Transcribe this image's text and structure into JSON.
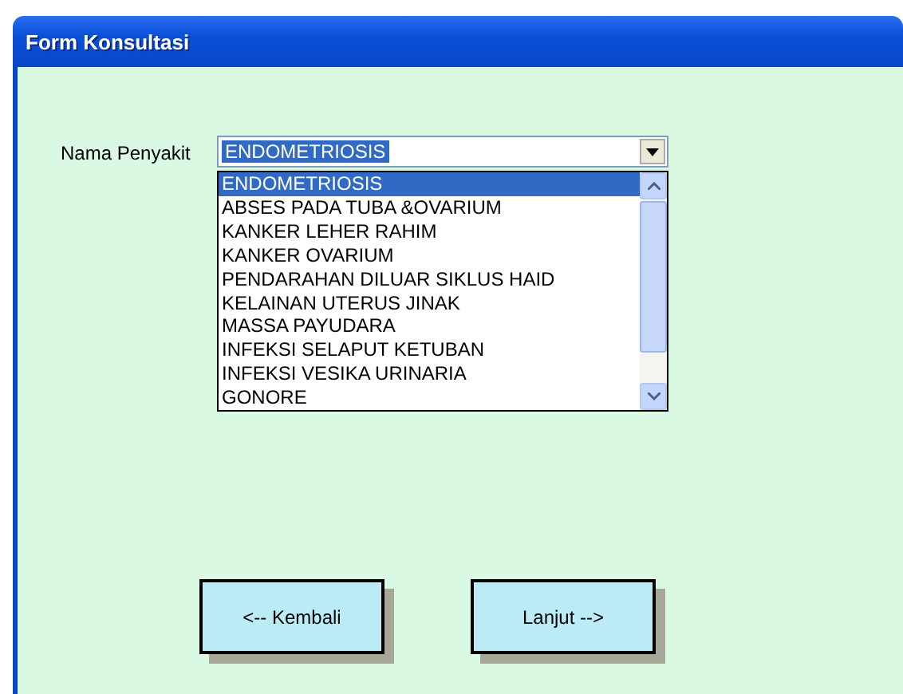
{
  "window": {
    "title": "Form Konsultasi"
  },
  "field": {
    "label": "Nama Penyakit",
    "value": "ENDOMETRIOSIS",
    "expanded": true
  },
  "options": [
    {
      "label": "ENDOMETRIOSIS",
      "selected": true
    },
    {
      "label": "ABSES PADA TUBA &OVARIUM",
      "selected": false
    },
    {
      "label": "KANKER LEHER RAHIM",
      "selected": false
    },
    {
      "label": "KANKER OVARIUM",
      "selected": false
    },
    {
      "label": "PENDARAHAN DILUAR SIKLUS HAID",
      "selected": false
    },
    {
      "label": "KELAINAN UTERUS JINAK",
      "selected": false
    },
    {
      "label": "MASSA PAYUDARA",
      "selected": false
    },
    {
      "label": "INFEKSI SELAPUT KETUBAN",
      "selected": false
    },
    {
      "label": "INFEKSI VESIKA URINARIA",
      "selected": false
    },
    {
      "label": "GONORE",
      "selected": false
    }
  ],
  "buttons": [
    "<-- Kembali",
    "Lanjut -->"
  ]
}
